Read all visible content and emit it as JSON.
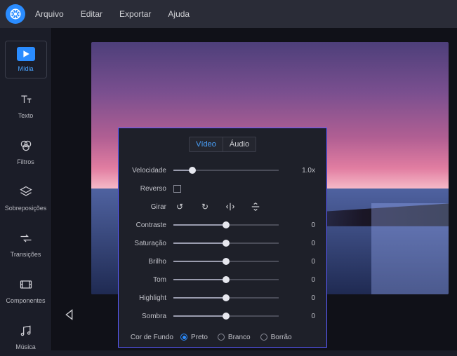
{
  "menubar": {
    "items": [
      "Arquivo",
      "Editar",
      "Exportar",
      "Ajuda"
    ]
  },
  "sidebar": {
    "items": [
      {
        "label": "Mídia"
      },
      {
        "label": "Texto"
      },
      {
        "label": "Filtros"
      },
      {
        "label": "Sobreposições"
      },
      {
        "label": "Transições"
      },
      {
        "label": "Componentes"
      },
      {
        "label": "Música"
      }
    ]
  },
  "panel": {
    "tabs": {
      "video": "Vídeo",
      "audio": "Áudio"
    },
    "speed": {
      "label": "Velocidade",
      "value": "1.0x",
      "pct": 18
    },
    "reverse": {
      "label": "Reverso"
    },
    "rotate": {
      "label": "Girar"
    },
    "sliders": [
      {
        "label": "Contraste",
        "value": "0",
        "pct": 50
      },
      {
        "label": "Saturação",
        "value": "0",
        "pct": 50
      },
      {
        "label": "Brilho",
        "value": "0",
        "pct": 50
      },
      {
        "label": "Tom",
        "value": "0",
        "pct": 50
      },
      {
        "label": "Highlight",
        "value": "0",
        "pct": 50
      },
      {
        "label": "Sombra",
        "value": "0",
        "pct": 50
      }
    ],
    "bg": {
      "label": "Cor de Fundo",
      "options": [
        "Preto",
        "Branco",
        "Borrão"
      ],
      "selected": 0
    }
  }
}
